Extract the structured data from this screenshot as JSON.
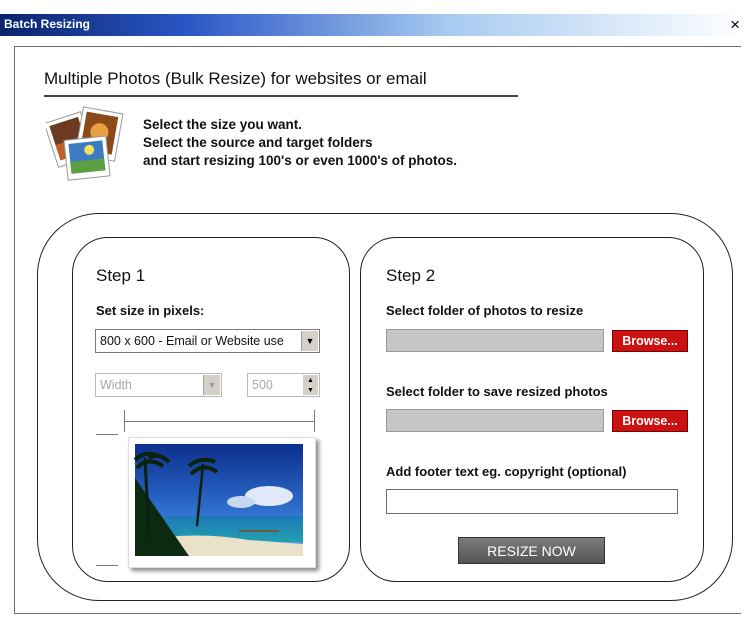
{
  "window": {
    "title": "Batch Resizing",
    "close_label": "×"
  },
  "header": {
    "heading": "Multiple Photos (Bulk Resize) for websites or email",
    "intro_lines": [
      "Select the size you want.",
      "Select the source and target folders",
      "and start resizing 100's or even 1000's of photos."
    ]
  },
  "step1": {
    "title": "Step 1",
    "size_label": "Set size in pixels:",
    "size_select": "800 x 600 - Email or Website use",
    "dimension_select": "Width",
    "dimension_value": "500"
  },
  "step2": {
    "title": "Step 2",
    "source_label": "Select folder of photos to resize",
    "target_label": "Select folder to save resized photos",
    "browse_label": "Browse...",
    "footer_label": "Add footer text eg. copyright (optional)",
    "source_value": "",
    "target_value": "",
    "footer_value": "",
    "resize_label": "RESIZE NOW"
  },
  "colors": {
    "browse": "#cc1111",
    "title_bar": "#0a246a",
    "field_gray": "#c6c6c6"
  }
}
